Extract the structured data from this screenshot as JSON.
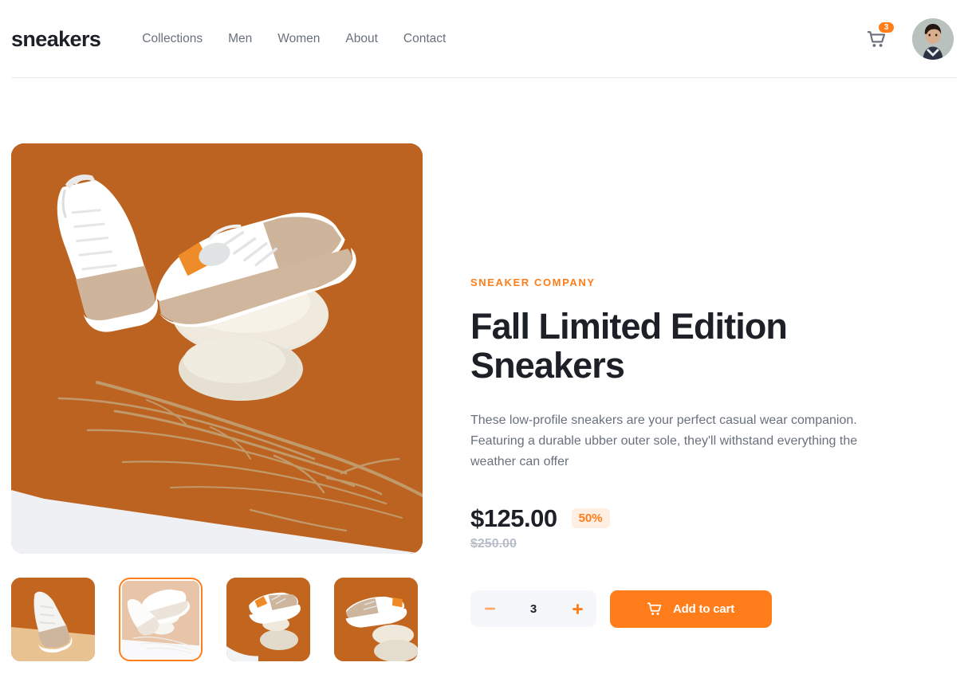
{
  "header": {
    "logo": "sneakers",
    "nav": [
      {
        "label": "Collections"
      },
      {
        "label": "Men"
      },
      {
        "label": "Women"
      },
      {
        "label": "About"
      },
      {
        "label": "Contact"
      }
    ],
    "cart": {
      "icon": "cart-icon",
      "badge_count": "3"
    },
    "avatar": {
      "icon": "user-avatar"
    }
  },
  "gallery": {
    "hero": {
      "alt": "Fall Limited Edition Sneakers resting on stacked stones with twigs on an orange backdrop"
    },
    "thumbnails": [
      {
        "alt": "Sneaker standing upright on tan floor",
        "selected": false
      },
      {
        "alt": "Pair of sneakers balanced on stones",
        "selected": true
      },
      {
        "alt": "Sneaker on two stacked stones with curled orange paper",
        "selected": false
      },
      {
        "alt": "Side view sneaker on stacked stones",
        "selected": false
      }
    ]
  },
  "product": {
    "brand": "Sneaker Company",
    "title": "Fall Limited Edition Sneakers",
    "description": "These low-profile sneakers are your perfect casual wear companion. Featuring a durable ubber outer sole, they'll withstand everything the weather can offer",
    "price_current": "$125.00",
    "discount": "50%",
    "price_old": "$250.00",
    "quantity": "3",
    "decrease_label": "minus-icon",
    "increase_label": "plus-icon",
    "add_to_cart_label": "Add to cart"
  },
  "colors": {
    "accent": "#ff7d1a",
    "accent_pale": "#ffeee2",
    "text_dark": "#1d2026",
    "text_gray": "#69707d",
    "text_muted": "#b6bcc8",
    "surface": "#f6f7fb",
    "divider": "#e4e9f2"
  }
}
